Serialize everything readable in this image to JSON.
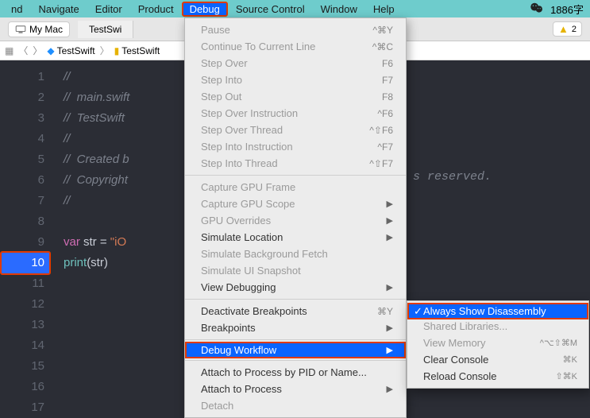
{
  "menubar": {
    "items": [
      "nd",
      "Navigate",
      "Editor",
      "Product",
      "Debug",
      "Source Control",
      "Window",
      "Help"
    ],
    "selectedIndex": 4,
    "rightCount": "1886字"
  },
  "subbar": {
    "device": "My Mac",
    "tab": "TestSwi",
    "warnCount": "2"
  },
  "pathbar": {
    "crumbs": [
      "TestSwift",
      "TestSwift"
    ]
  },
  "editor": {
    "lines": [
      {
        "n": 1,
        "t": "cmt",
        "s": "//"
      },
      {
        "n": 2,
        "t": "cmt",
        "s": "//  main.swift"
      },
      {
        "n": 3,
        "t": "cmt",
        "s": "//  TestSwift"
      },
      {
        "n": 4,
        "t": "cmt",
        "s": "//"
      },
      {
        "n": 5,
        "t": "cmt",
        "s": "//  Created b"
      },
      {
        "n": 6,
        "t": "cmt",
        "s": "//  Copyright"
      },
      {
        "n": 7,
        "t": "cmt",
        "s": "//"
      },
      {
        "n": 8,
        "t": "",
        "s": ""
      },
      {
        "n": 9,
        "t": "code",
        "s": "var str = \"iO"
      },
      {
        "n": 10,
        "t": "code",
        "s": "print(str)",
        "bp": true
      },
      {
        "n": 11,
        "t": "",
        "s": ""
      },
      {
        "n": 12,
        "t": "",
        "s": ""
      },
      {
        "n": 13,
        "t": "",
        "s": ""
      },
      {
        "n": 14,
        "t": "",
        "s": ""
      },
      {
        "n": 15,
        "t": "",
        "s": ""
      },
      {
        "n": 16,
        "t": "",
        "s": ""
      },
      {
        "n": 17,
        "t": "",
        "s": ""
      }
    ],
    "rightsText": "s reserved."
  },
  "menu": {
    "groups": [
      [
        {
          "label": "Pause",
          "sc": "^⌘Y",
          "dis": true
        },
        {
          "label": "Continue To Current Line",
          "sc": "^⌘C",
          "dis": true
        },
        {
          "label": "Step Over",
          "sc": "F6",
          "dis": true
        },
        {
          "label": "Step Into",
          "sc": "F7",
          "dis": true
        },
        {
          "label": "Step Out",
          "sc": "F8",
          "dis": true
        },
        {
          "label": "Step Over Instruction",
          "sc": "^F6",
          "dis": true
        },
        {
          "label": "Step Over Thread",
          "sc": "^⇧F6",
          "dis": true
        },
        {
          "label": "Step Into Instruction",
          "sc": "^F7",
          "dis": true
        },
        {
          "label": "Step Into Thread",
          "sc": "^⇧F7",
          "dis": true
        }
      ],
      [
        {
          "label": "Capture GPU Frame",
          "dis": true
        },
        {
          "label": "Capture GPU Scope",
          "sub": true,
          "dis": true
        },
        {
          "label": "GPU Overrides",
          "sub": true,
          "dis": true
        },
        {
          "label": "Simulate Location",
          "sub": true
        },
        {
          "label": "Simulate Background Fetch",
          "dis": true
        },
        {
          "label": "Simulate UI Snapshot",
          "dis": true
        },
        {
          "label": "View Debugging",
          "sub": true
        }
      ],
      [
        {
          "label": "Deactivate Breakpoints",
          "sc": "⌘Y"
        },
        {
          "label": "Breakpoints",
          "sub": true
        }
      ],
      [
        {
          "label": "Debug Workflow",
          "sub": true,
          "hl": true
        }
      ],
      [
        {
          "label": "Attach to Process by PID or Name..."
        },
        {
          "label": "Attach to Process",
          "sub": true
        },
        {
          "label": "Detach",
          "dis": true
        }
      ]
    ]
  },
  "submenu": {
    "items": [
      {
        "label": "Always Show Disassembly",
        "hl": true,
        "chk": true
      },
      {
        "label": "Shared Libraries...",
        "dis": true
      },
      {
        "label": "View Memory",
        "sc": "^⌥⇧⌘M",
        "dis": true
      },
      {
        "label": "Clear Console",
        "sc": "⌘K"
      },
      {
        "label": "Reload Console",
        "sc": "⇧⌘K"
      }
    ]
  }
}
